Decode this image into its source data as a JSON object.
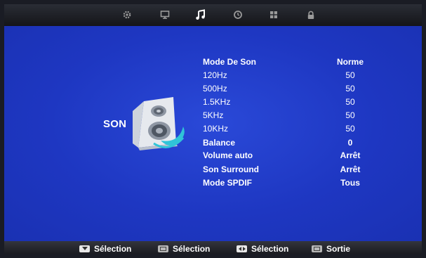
{
  "tabs": [
    {
      "id": "picture",
      "icon": "gear-icon"
    },
    {
      "id": "display",
      "icon": "monitor-icon"
    },
    {
      "id": "sound",
      "icon": "music-note-icon",
      "active": true
    },
    {
      "id": "time",
      "icon": "clock-icon"
    },
    {
      "id": "setup",
      "icon": "grid-icon"
    },
    {
      "id": "lock",
      "icon": "lock-icon"
    }
  ],
  "section": {
    "title": "SON",
    "icon": "speaker-icon",
    "accent": "#30c4d8"
  },
  "menu": [
    {
      "label": "Mode De Son",
      "value": "Norme"
    },
    {
      "label": "120Hz",
      "value": "50"
    },
    {
      "label": "500Hz",
      "value": "50"
    },
    {
      "label": "1.5KHz",
      "value": "50"
    },
    {
      "label": "5KHz",
      "value": "50"
    },
    {
      "label": "10KHz",
      "value": "50"
    },
    {
      "label": "Balance",
      "value": "0"
    },
    {
      "label": "Volume auto",
      "value": "Arrêt"
    },
    {
      "label": "Son Surround",
      "value": "Arrêt"
    },
    {
      "label": "Mode SPDIF",
      "value": "Tous"
    }
  ],
  "footer": [
    {
      "icon": "arrow-down-key-icon",
      "label": "Sélection"
    },
    {
      "icon": "ok-key-icon",
      "label": "Sélection"
    },
    {
      "icon": "left-right-key-icon",
      "label": "Sélection"
    },
    {
      "icon": "menu-key-icon",
      "label": "Sortie"
    }
  ],
  "colors": {
    "background": "#1f38c4",
    "bar": "#25272e",
    "text": "#ffffff"
  }
}
